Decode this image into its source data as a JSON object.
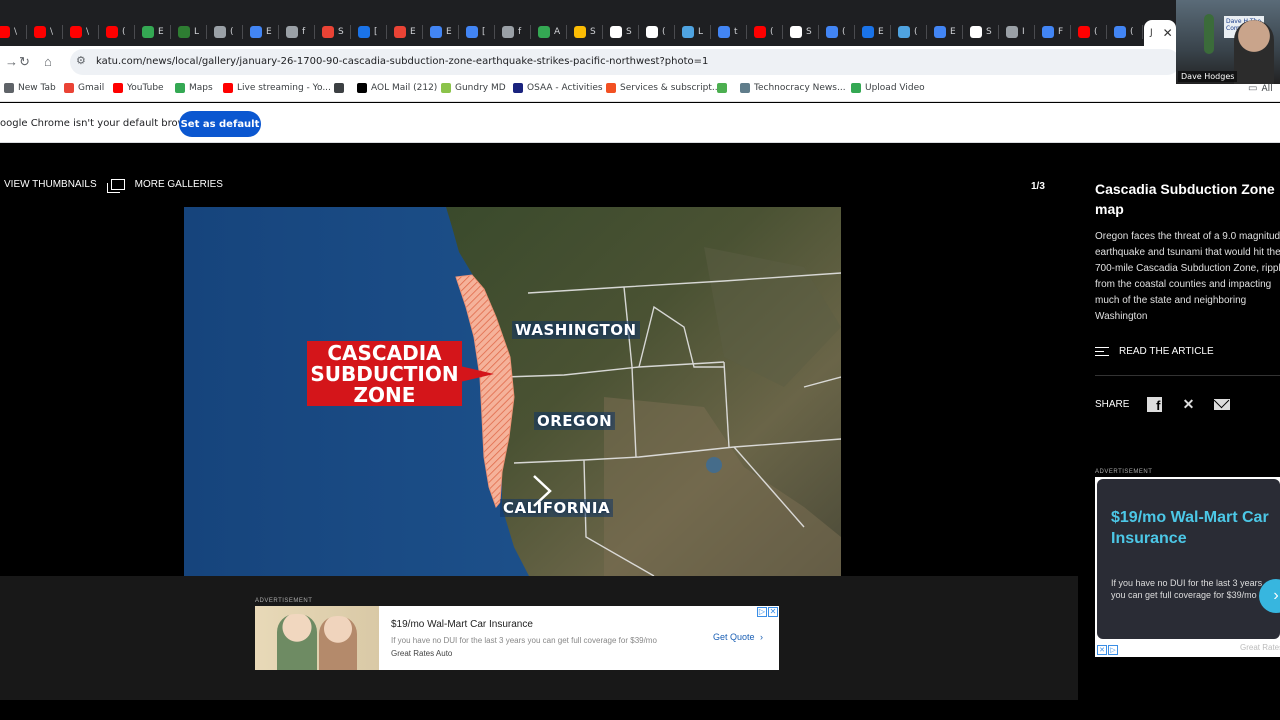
{
  "browser": {
    "tabs": [
      {
        "letter": "\\",
        "color": "#ff0000"
      },
      {
        "letter": "\\",
        "color": "#ff0000"
      },
      {
        "letter": "\\",
        "color": "#ff0000"
      },
      {
        "letter": "(",
        "color": "#ff0000"
      },
      {
        "letter": "E",
        "color": "#34a853"
      },
      {
        "letter": "L",
        "color": "#2e7d32"
      },
      {
        "letter": "(",
        "color": "#9aa0a6"
      },
      {
        "letter": "E",
        "color": "#4285f4"
      },
      {
        "letter": "f",
        "color": "#9aa0a6"
      },
      {
        "letter": "S",
        "color": "#ea4335"
      },
      {
        "letter": "[",
        "color": "#1a73e8"
      },
      {
        "letter": "E",
        "color": "#ea4335"
      },
      {
        "letter": "E",
        "color": "#4285f4"
      },
      {
        "letter": "[",
        "color": "#4285f4"
      },
      {
        "letter": "f",
        "color": "#9aa0a6"
      },
      {
        "letter": "A",
        "color": "#34a853"
      },
      {
        "letter": "S",
        "color": "#fbbc04"
      },
      {
        "letter": "S",
        "color": "#ffffff"
      },
      {
        "letter": "(",
        "color": "#ffffff"
      },
      {
        "letter": "L",
        "color": "#4fa3e0"
      },
      {
        "letter": "t",
        "color": "#4285f4"
      },
      {
        "letter": "(",
        "color": "#ff0000"
      },
      {
        "letter": "S",
        "color": "#ffffff"
      },
      {
        "letter": "(",
        "color": "#4285f4"
      },
      {
        "letter": "E",
        "color": "#1a73e8"
      },
      {
        "letter": "(",
        "color": "#4fa3e0"
      },
      {
        "letter": "E",
        "color": "#4285f4"
      },
      {
        "letter": "S",
        "color": "#ffffff"
      },
      {
        "letter": "I",
        "color": "#9aa0a6"
      },
      {
        "letter": "F",
        "color": "#4285f4"
      },
      {
        "letter": "(",
        "color": "#ff0000"
      },
      {
        "letter": "(",
        "color": "#4285f4"
      },
      {
        "letter": "J",
        "color": "#ffffff"
      }
    ],
    "active_tab_close": "✕",
    "url": "katu.com/news/local/gallery/january-26-1700-90-cascadia-subduction-zone-earthquake-strikes-pacific-northwest?photo=1",
    "bookmarks": [
      {
        "label": "New Tab",
        "color": "#5f6368"
      },
      {
        "label": "Gmail",
        "color": "#ea4335"
      },
      {
        "label": "YouTube",
        "color": "#ff0000"
      },
      {
        "label": "Maps",
        "color": "#34a853"
      },
      {
        "label": "Live streaming - Yo...",
        "color": "#ff0000"
      },
      {
        "label": "",
        "color": "#3c4043"
      },
      {
        "label": "AOL Mail (212)",
        "color": "#000000"
      },
      {
        "label": "Gundry MD",
        "color": "#8bc34a"
      },
      {
        "label": "OSAA - Activities",
        "color": "#1a237e"
      },
      {
        "label": "Services & subscript...",
        "color": "#f25022"
      },
      {
        "label": "",
        "color": "#4caf50"
      },
      {
        "label": "Technocracy News...",
        "color": "#607d8b"
      },
      {
        "label": "Upload Video",
        "color": "#34a853"
      }
    ],
    "all_bookmarks": "All",
    "infobar_text": "oogle Chrome isn't your default browser",
    "set_default_label": "Set as default"
  },
  "webcam": {
    "name": "Dave Hodges",
    "sign_text": "Dave H The Comm"
  },
  "gallery": {
    "view_thumbnails": "VIEW THUMBNAILS",
    "more_galleries": "MORE GALLERIES",
    "counter": "1/3",
    "map_labels": {
      "washington": "WASHINGTON",
      "oregon": "OREGON",
      "california": "CALIFORNIA",
      "zone_line1": "CASCADIA",
      "zone_line2": "SUBDUCTION",
      "zone_line3": "ZONE"
    }
  },
  "sidebar": {
    "title": "Cascadia Subduction Zone map",
    "description": "Oregon faces the threat of a 9.0 magnitude earthquake and tsunami that would hit the 700-mile Cascadia Subduction Zone, rippling from the coastal counties and impacting much of the state and neighboring Washington",
    "read_article": "READ THE ARTICLE",
    "share_label": "SHARE",
    "ad_label": "ADVERTISEMENT",
    "ad_headline": "$19/mo Wal-Mart Car Insurance",
    "ad_text": "If you have no DUI for the last 3 years you can get full coverage for $39/mo",
    "ad_source": "Great Rates Auto"
  },
  "bottom_ad": {
    "label": "ADVERTISEMENT",
    "title": "$19/mo Wal-Mart Car Insurance",
    "desc": "If you have no DUI for the last 3 years you can get full coverage for $39/mo",
    "source": "Great Rates Auto",
    "cta": "Get Quote"
  }
}
